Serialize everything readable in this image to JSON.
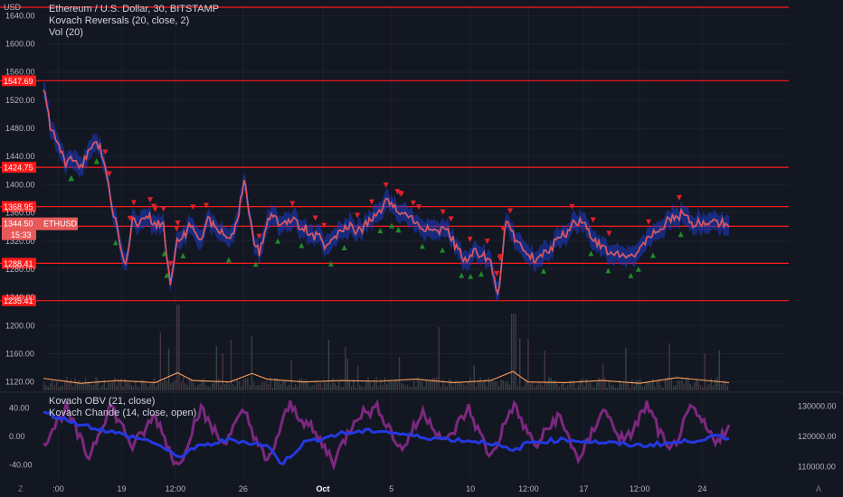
{
  "header": {
    "symbol_line": "Ethereum / U.S. Dollar, 30, BITSTAMP",
    "indicator_1": "Kovach Reversals (20, close, 2)",
    "indicator_2": "Vol (20)",
    "indicator_3": "Kovach OBV (21, close)",
    "indicator_4": "Kovach Chande (14, close, open)",
    "currency": "USD"
  },
  "corner_icons": {
    "left": "Z",
    "right": "A"
  },
  "colors": {
    "background": "#131722",
    "resistance_line": "#ff1a1a",
    "price_ribbon": "#e8434b",
    "band": "#1e3ac8",
    "up_marker": "#1f8a2a",
    "down_marker": "#e0202a",
    "volume_ma": "#ff9f5a",
    "obv": "#2438e0",
    "chande": "#8f2b8f"
  },
  "chart_data": {
    "type": "line",
    "title": "Ethereum / U.S. Dollar, 30, BITSTAMP",
    "symbol": "ETHUSD",
    "last_price": "1344.50",
    "countdown": "15:33",
    "price_axis": {
      "ylim": [
        1108,
        1652
      ],
      "ticks": [
        "1120.00",
        "1160.00",
        "1200.00",
        "1240.00",
        "1280.00",
        "1320.00",
        "1360.00",
        "1400.00",
        "1440.00",
        "1480.00",
        "1520.00",
        "1560.00",
        "1600.00",
        "1640.00"
      ]
    },
    "horizontal_levels": [
      {
        "value": 1652.0,
        "label": ""
      },
      {
        "value": 1547.69,
        "label": "1547.69"
      },
      {
        "value": 1424.75,
        "label": "1424.75"
      },
      {
        "value": 1368.95,
        "label": "1368.95"
      },
      {
        "value": 1341.04,
        "label": "1341.04"
      },
      {
        "value": 1288.41,
        "label": "1288.41"
      },
      {
        "value": 1235.41,
        "label": "1235.41"
      }
    ],
    "time_axis": {
      "ticks": [
        {
          "label": ":00",
          "pos": 0.02
        },
        {
          "label": "19",
          "pos": 0.105
        },
        {
          "label": "12:00",
          "pos": 0.177
        },
        {
          "label": "26",
          "pos": 0.268
        },
        {
          "label": "Oct",
          "pos": 0.375
        },
        {
          "label": "5",
          "pos": 0.467
        },
        {
          "label": "10",
          "pos": 0.573
        },
        {
          "label": "12:00",
          "pos": 0.651
        },
        {
          "label": "17",
          "pos": 0.725
        },
        {
          "label": "12:00",
          "pos": 0.8
        },
        {
          "label": "24",
          "pos": 0.884
        }
      ]
    },
    "price_series": {
      "name": "",
      "x": [
        0,
        0.01,
        0.02,
        0.03,
        0.04,
        0.05,
        0.06,
        0.07,
        0.08,
        0.09,
        0.1,
        0.11,
        0.12,
        0.13,
        0.14,
        0.15,
        0.16,
        0.17,
        0.18,
        0.19,
        0.2,
        0.21,
        0.22,
        0.23,
        0.24,
        0.25,
        0.26,
        0.27,
        0.28,
        0.29,
        0.3,
        0.31,
        0.32,
        0.33,
        0.34,
        0.35,
        0.36,
        0.37,
        0.38,
        0.39,
        0.4,
        0.41,
        0.42,
        0.43,
        0.44,
        0.45,
        0.46,
        0.47,
        0.48,
        0.49,
        0.5,
        0.51,
        0.52,
        0.53,
        0.54,
        0.55,
        0.56,
        0.57,
        0.58,
        0.59,
        0.6,
        0.61,
        0.62,
        0.63,
        0.64,
        0.65,
        0.66,
        0.67,
        0.68,
        0.69,
        0.7,
        0.71,
        0.72,
        0.73,
        0.74,
        0.75,
        0.76,
        0.77,
        0.78,
        0.79,
        0.8,
        0.81,
        0.82,
        0.83,
        0.84,
        0.85,
        0.86,
        0.87,
        0.88,
        0.89,
        0.9,
        0.91,
        0.92
      ],
      "y": [
        1540,
        1480,
        1455,
        1430,
        1440,
        1420,
        1450,
        1465,
        1440,
        1380,
        1330,
        1290,
        1350,
        1345,
        1360,
        1340,
        1350,
        1260,
        1320,
        1330,
        1345,
        1320,
        1350,
        1340,
        1330,
        1320,
        1350,
        1410,
        1330,
        1300,
        1350,
        1355,
        1340,
        1350,
        1345,
        1340,
        1325,
        1330,
        1310,
        1320,
        1335,
        1345,
        1330,
        1340,
        1350,
        1360,
        1375,
        1368,
        1362,
        1355,
        1345,
        1340,
        1335,
        1330,
        1340,
        1320,
        1300,
        1295,
        1305,
        1300,
        1290,
        1240,
        1350,
        1330,
        1310,
        1300,
        1295,
        1305,
        1310,
        1320,
        1330,
        1345,
        1350,
        1340,
        1320,
        1310,
        1305,
        1300,
        1295,
        1300,
        1310,
        1320,
        1330,
        1340,
        1350,
        1355,
        1360,
        1345,
        1345,
        1350,
        1345,
        1345,
        1344.5
      ]
    },
    "volume_ma": {
      "name": "",
      "x": [
        0,
        0.05,
        0.1,
        0.15,
        0.18,
        0.2,
        0.25,
        0.28,
        0.3,
        0.35,
        0.4,
        0.45,
        0.5,
        0.55,
        0.6,
        0.63,
        0.65,
        0.7,
        0.75,
        0.8,
        0.85,
        0.9,
        0.92
      ],
      "y": [
        1125,
        1118,
        1122,
        1119,
        1133,
        1122,
        1120,
        1132,
        1124,
        1120,
        1122,
        1121,
        1124,
        1119,
        1122,
        1135,
        1120,
        1119,
        1122,
        1118,
        1126,
        1121,
        1119
      ]
    },
    "lower_pane": {
      "left_ticks": [
        "40.00",
        "0.00",
        "-40.00"
      ],
      "right_ticks": [
        "130000.00",
        "120000.00",
        "110000.00"
      ],
      "chande_range": [
        -60,
        60
      ],
      "obv_range": [
        106000,
        134000
      ],
      "chande": {
        "name": "",
        "x": [
          0,
          0.03,
          0.06,
          0.09,
          0.12,
          0.15,
          0.18,
          0.21,
          0.24,
          0.27,
          0.3,
          0.33,
          0.36,
          0.39,
          0.42,
          0.45,
          0.48,
          0.51,
          0.54,
          0.57,
          0.6,
          0.63,
          0.66,
          0.69,
          0.72,
          0.75,
          0.78,
          0.81,
          0.84,
          0.87,
          0.9,
          0.92
        ],
        "y": [
          -10,
          40,
          -30,
          45,
          -15,
          30,
          -45,
          40,
          -10,
          35,
          -40,
          45,
          10,
          -35,
          30,
          40,
          -20,
          35,
          -10,
          40,
          -30,
          45,
          -15,
          30,
          -35,
          40,
          -10,
          45,
          -25,
          40,
          -5,
          10
        ]
      },
      "obv": {
        "name": "",
        "x": [
          0,
          0.05,
          0.1,
          0.15,
          0.18,
          0.2,
          0.25,
          0.3,
          0.32,
          0.35,
          0.4,
          0.45,
          0.5,
          0.55,
          0.6,
          0.63,
          0.65,
          0.7,
          0.75,
          0.8,
          0.85,
          0.88,
          0.9,
          0.92
        ],
        "y": [
          128000,
          124000,
          121000,
          118000,
          113000,
          116000,
          119000,
          117000,
          111000,
          118000,
          121000,
          122000,
          120000,
          119000,
          118000,
          115000,
          118000,
          119000,
          118000,
          117000,
          118000,
          119000,
          120000,
          119000
        ]
      }
    }
  }
}
